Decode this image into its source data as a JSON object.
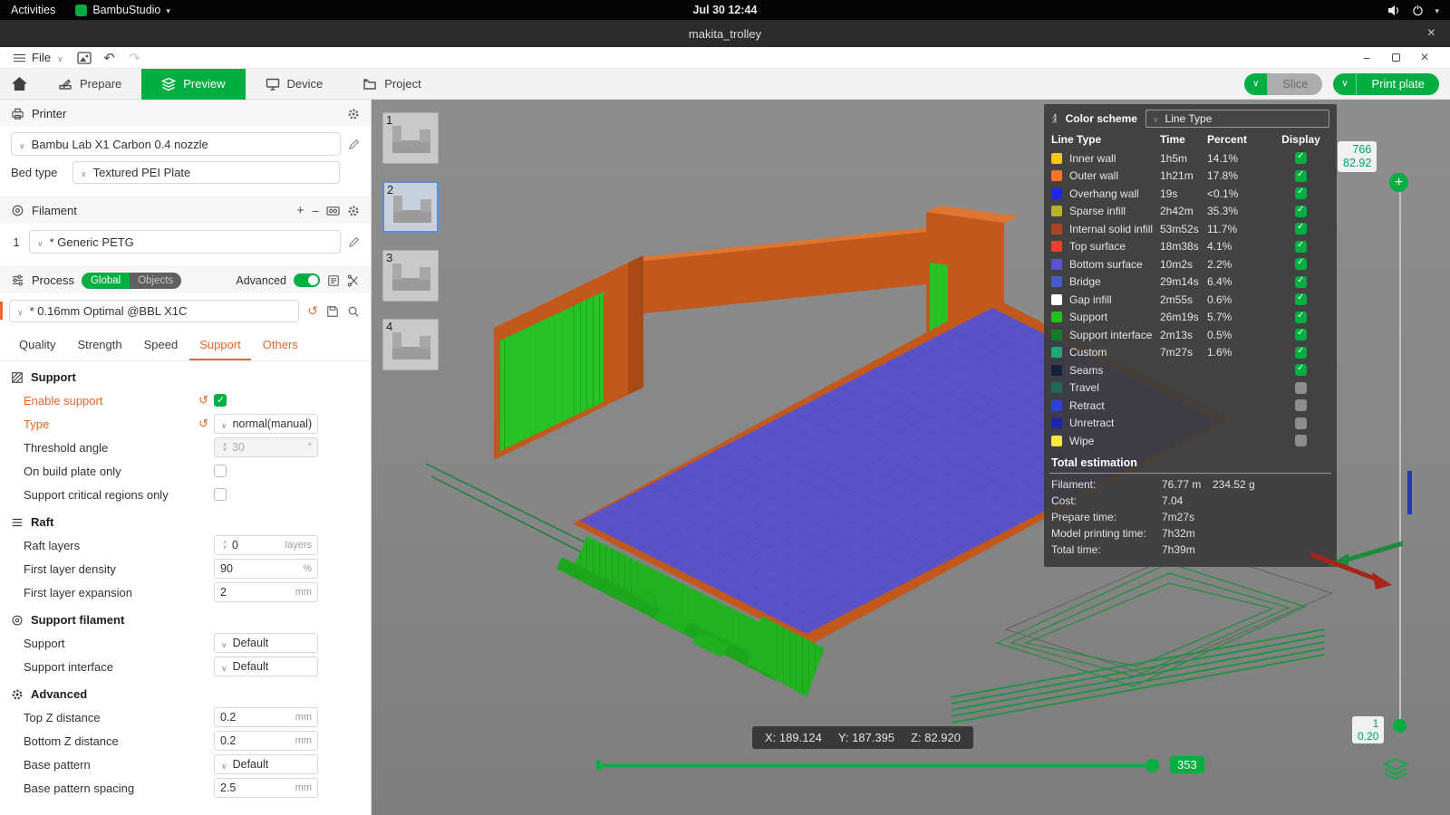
{
  "colors": {
    "accent_green": "#00AE42",
    "accent_orange": "#E8672C"
  },
  "topbar": {
    "activities": "Activities",
    "app_name": "BambuStudio",
    "clock": "Jul 30 12:44"
  },
  "window": {
    "title": "makita_trolley"
  },
  "menubar": {
    "file_label": "File"
  },
  "icons": {
    "undo": "↶",
    "redo": "↷"
  },
  "nav": {
    "tabs": [
      {
        "label": "Prepare",
        "active": false
      },
      {
        "label": "Preview",
        "active": true
      },
      {
        "label": "Device",
        "active": false
      },
      {
        "label": "Project",
        "active": false
      }
    ],
    "slice_label": "Slice",
    "print_plate_label": "Print plate"
  },
  "sidebar": {
    "printer": {
      "title": "Printer",
      "preset": "Bambu Lab X1 Carbon 0.4 nozzle",
      "bed_type_label": "Bed type",
      "bed_type_value": "Textured PEI Plate"
    },
    "filament": {
      "title": "Filament",
      "slot": "1",
      "preset": "* Generic PETG"
    },
    "process": {
      "title": "Process",
      "seg_global": "Global",
      "seg_objects": "Objects",
      "advanced_label": "Advanced",
      "advanced_on": true,
      "preset": "* 0.16mm Optimal @BBL X1C",
      "active_tab": "Support",
      "tabs": [
        {
          "label": "Quality"
        },
        {
          "label": "Strength"
        },
        {
          "label": "Speed"
        },
        {
          "label": "Support",
          "active": true
        },
        {
          "label": "Others",
          "highlighted": true
        }
      ]
    },
    "groups": {
      "support_title": "Support",
      "raft_title": "Raft",
      "support_filament_title": "Support filament",
      "advanced_title": "Advanced"
    },
    "settings": {
      "enable_support": {
        "label": "Enable support",
        "checked": true
      },
      "type": {
        "label": "Type",
        "value": "normal(manual)"
      },
      "threshold_angle": {
        "label": "Threshold angle",
        "value": "30",
        "suffix": "°",
        "disabled": true
      },
      "on_build_plate_only": {
        "label": "On build plate only",
        "checked": false
      },
      "support_critical_regions_only": {
        "label": "Support critical regions only",
        "checked": false
      },
      "raft_layers": {
        "label": "Raft layers",
        "value": "0",
        "suffix": "layers"
      },
      "first_layer_density": {
        "label": "First layer density",
        "value": "90",
        "suffix": "%"
      },
      "first_layer_expansion": {
        "label": "First layer expansion",
        "value": "2",
        "suffix": "mm"
      },
      "support_filament": {
        "label": "Support",
        "value": "Default"
      },
      "support_interface_filament": {
        "label": "Support interface",
        "value": "Default"
      },
      "top_z_distance": {
        "label": "Top Z distance",
        "value": "0.2",
        "suffix": "mm"
      },
      "bottom_z_distance": {
        "label": "Bottom Z distance",
        "value": "0.2",
        "suffix": "mm"
      },
      "base_pattern": {
        "label": "Base pattern",
        "value": "Default"
      },
      "base_pattern_spacing": {
        "label": "Base pattern spacing",
        "value": "2.5",
        "suffix": "mm"
      }
    }
  },
  "plates": {
    "items": [
      {
        "n": "1",
        "selected": false
      },
      {
        "n": "2",
        "selected": true
      },
      {
        "n": "3",
        "selected": false
      },
      {
        "n": "4",
        "selected": false
      }
    ]
  },
  "legend": {
    "title": "Color scheme",
    "scheme_value": "Line Type",
    "col_type": "Line Type",
    "col_time": "Time",
    "col_percent": "Percent",
    "col_display": "Display",
    "rows": [
      {
        "label": "Inner wall",
        "color": "#FDC700",
        "time": "1h5m",
        "percent": "14.1%",
        "checked": true
      },
      {
        "label": "Outer wall",
        "color": "#F0742A",
        "time": "1h21m",
        "percent": "17.8%",
        "checked": true
      },
      {
        "label": "Overhang wall",
        "color": "#2023F5",
        "time": "19s",
        "percent": "<0.1%",
        "checked": true
      },
      {
        "label": "Sparse infill",
        "color": "#B9B22B",
        "time": "2h42m",
        "percent": "35.3%",
        "checked": true
      },
      {
        "label": "Internal solid infill",
        "color": "#A94526",
        "time": "53m52s",
        "percent": "11.7%",
        "checked": true
      },
      {
        "label": "Top surface",
        "color": "#F0402E",
        "time": "18m38s",
        "percent": "4.1%",
        "checked": true
      },
      {
        "label": "Bottom surface",
        "color": "#5C53CE",
        "time": "10m2s",
        "percent": "2.2%",
        "checked": true
      },
      {
        "label": "Bridge",
        "color": "#4A5CCB",
        "time": "29m14s",
        "percent": "6.4%",
        "checked": true
      },
      {
        "label": "Gap infill",
        "color": "#FFFFFF",
        "time": "2m55s",
        "percent": "0.6%",
        "checked": true
      },
      {
        "label": "Support",
        "color": "#21C21F",
        "time": "26m19s",
        "percent": "5.7%",
        "checked": true
      },
      {
        "label": "Support interface",
        "color": "#127D26",
        "time": "2m13s",
        "percent": "0.5%",
        "checked": true
      },
      {
        "label": "Custom",
        "color": "#1DA878",
        "time": "7m27s",
        "percent": "1.6%",
        "checked": true
      },
      {
        "label": "Seams",
        "color": "#14233B",
        "time": "",
        "percent": "",
        "checked": true
      },
      {
        "label": "Travel",
        "color": "#1C6B52",
        "time": "",
        "percent": "",
        "checked": false
      },
      {
        "label": "Retract",
        "color": "#2C41D8",
        "time": "",
        "percent": "",
        "checked": false
      },
      {
        "label": "Unretract",
        "color": "#1926A8",
        "time": "",
        "percent": "",
        "checked": false
      },
      {
        "label": "Wipe",
        "color": "#F8E93C",
        "time": "",
        "percent": "",
        "checked": false
      }
    ],
    "total": {
      "title": "Total estimation",
      "rows": [
        {
          "label": "Filament:",
          "value": "76.77 m",
          "value2": "234.52 g"
        },
        {
          "label": "Cost:",
          "value": "7.04",
          "value2": ""
        },
        {
          "label": "Prepare time:",
          "value": "7m27s",
          "value2": ""
        },
        {
          "label": "Model printing time:",
          "value": "7h32m",
          "value2": ""
        },
        {
          "label": "Total time:",
          "value": "7h39m",
          "value2": ""
        }
      ]
    }
  },
  "viewport": {
    "coords": {
      "x": "X: 189.124",
      "y": "Y: 187.395",
      "z": "Z: 82.920"
    },
    "layer_slider": {
      "top_value": "766",
      "top_height": "82.92",
      "bottom_value": "1",
      "bottom_height": "0.20"
    },
    "step_slider": {
      "value": "353"
    }
  }
}
